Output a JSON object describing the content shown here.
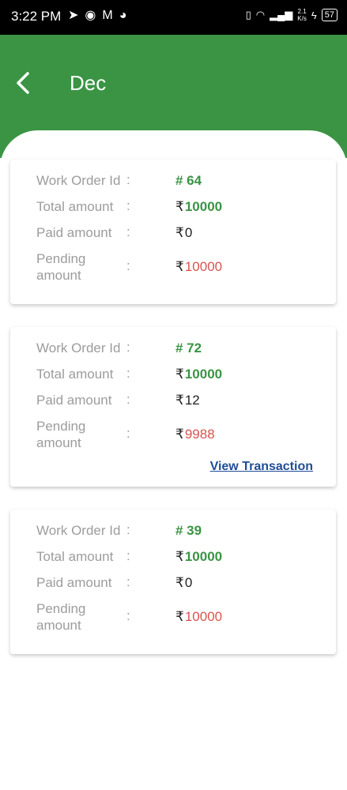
{
  "status_bar": {
    "time": "3:22 PM",
    "net_speed_top": "2.1",
    "net_speed_bottom": "K/s",
    "battery": "57"
  },
  "header": {
    "title": "Dec",
    "bg_color": "#3a9444"
  },
  "labels": {
    "work_order_id": "Work Order Id",
    "total_amount": "Total amount",
    "paid_amount": "Paid amount",
    "pending_line1": "Pending",
    "pending_line2": "amount",
    "colon": ":",
    "currency": "₹",
    "view_transaction": "View Transaction"
  },
  "orders": [
    {
      "id": "# 64",
      "total": "10000",
      "paid": "0",
      "pending": "10000",
      "has_transaction": false
    },
    {
      "id": "# 72",
      "total": "10000",
      "paid": "12",
      "pending": "9988",
      "has_transaction": true
    },
    {
      "id": "# 39",
      "total": "10000",
      "paid": "0",
      "pending": "10000",
      "has_transaction": false
    }
  ],
  "colors": {
    "accent_green": "#3a9444",
    "pending_red": "#d9534f",
    "link_blue": "#1f4e96"
  }
}
